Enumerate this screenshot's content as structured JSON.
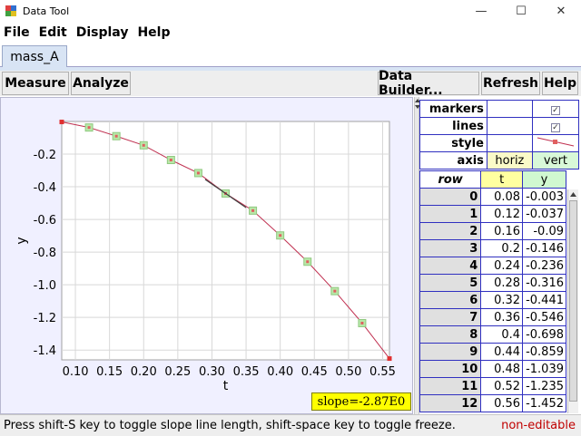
{
  "window": {
    "title": "Data Tool",
    "minimize": "—",
    "maximize": "☐",
    "close": "✕"
  },
  "menu": [
    "File",
    "Edit",
    "Display",
    "Help"
  ],
  "tabs": [
    {
      "label": "mass_A"
    }
  ],
  "toolbar": {
    "measure": "Measure",
    "analyze": "Analyze",
    "data_builder": "Data Builder...",
    "refresh": "Refresh",
    "help": "Help"
  },
  "properties": {
    "markers_label": "markers",
    "lines_label": "lines",
    "style_label": "style",
    "axis_label": "axis",
    "axis_t": "horiz",
    "axis_y": "vert",
    "check_mark": "✓"
  },
  "table": {
    "headers": {
      "row": "row",
      "t": "t",
      "y": "y"
    },
    "rows": [
      {
        "row": "0",
        "t": "0.08",
        "y": "-0.003"
      },
      {
        "row": "1",
        "t": "0.12",
        "y": "-0.037"
      },
      {
        "row": "2",
        "t": "0.16",
        "y": "-0.09"
      },
      {
        "row": "3",
        "t": "0.2",
        "y": "-0.146"
      },
      {
        "row": "4",
        "t": "0.24",
        "y": "-0.236"
      },
      {
        "row": "5",
        "t": "0.28",
        "y": "-0.316"
      },
      {
        "row": "6",
        "t": "0.32",
        "y": "-0.441"
      },
      {
        "row": "7",
        "t": "0.36",
        "y": "-0.546"
      },
      {
        "row": "8",
        "t": "0.4",
        "y": "-0.698"
      },
      {
        "row": "9",
        "t": "0.44",
        "y": "-0.859"
      },
      {
        "row": "10",
        "t": "0.48",
        "y": "-1.039"
      },
      {
        "row": "11",
        "t": "0.52",
        "y": "-1.235"
      },
      {
        "row": "12",
        "t": "0.56",
        "y": "-1.452"
      }
    ]
  },
  "chart_data": {
    "type": "scatter",
    "xlabel": "t",
    "ylabel": "y",
    "xlim": [
      0.08,
      0.56
    ],
    "ylim": [
      -1.46,
      0.0
    ],
    "xticks": [
      "0.10",
      "0.15",
      "0.20",
      "0.25",
      "0.30",
      "0.35",
      "0.40",
      "0.45",
      "0.50",
      "0.55"
    ],
    "xtick_values": [
      0.1,
      0.15,
      0.2,
      0.25,
      0.3,
      0.35,
      0.4,
      0.45,
      0.5,
      0.55
    ],
    "yticks": [
      "-0.2",
      "-0.4",
      "-0.6",
      "-0.8",
      "-1.0",
      "-1.2",
      "-1.4"
    ],
    "ytick_values": [
      -0.2,
      -0.4,
      -0.6,
      -0.8,
      -1.0,
      -1.2,
      -1.4
    ],
    "grid": true,
    "x": [
      0.08,
      0.12,
      0.16,
      0.2,
      0.24,
      0.28,
      0.32,
      0.36,
      0.4,
      0.44,
      0.48,
      0.52,
      0.56
    ],
    "y": [
      -0.003,
      -0.037,
      -0.09,
      -0.146,
      -0.236,
      -0.316,
      -0.441,
      -0.546,
      -0.698,
      -0.859,
      -1.039,
      -1.235,
      -1.452
    ],
    "highlight_index": [
      0,
      12
    ],
    "slope_point": {
      "t": 0.32,
      "y": -0.441,
      "slope": -2.87
    },
    "slope_label": "slope=-2.87E0",
    "line_color": "#c03050",
    "marker_fill": "#b8e8a8",
    "marker_center": "#e06060",
    "highlight_color": "#e03030",
    "slope_line_color": "#404040"
  },
  "status": {
    "message": "Press shift-S key to toggle slope line length, shift-space key to toggle freeze.",
    "editable": "non-editable"
  }
}
